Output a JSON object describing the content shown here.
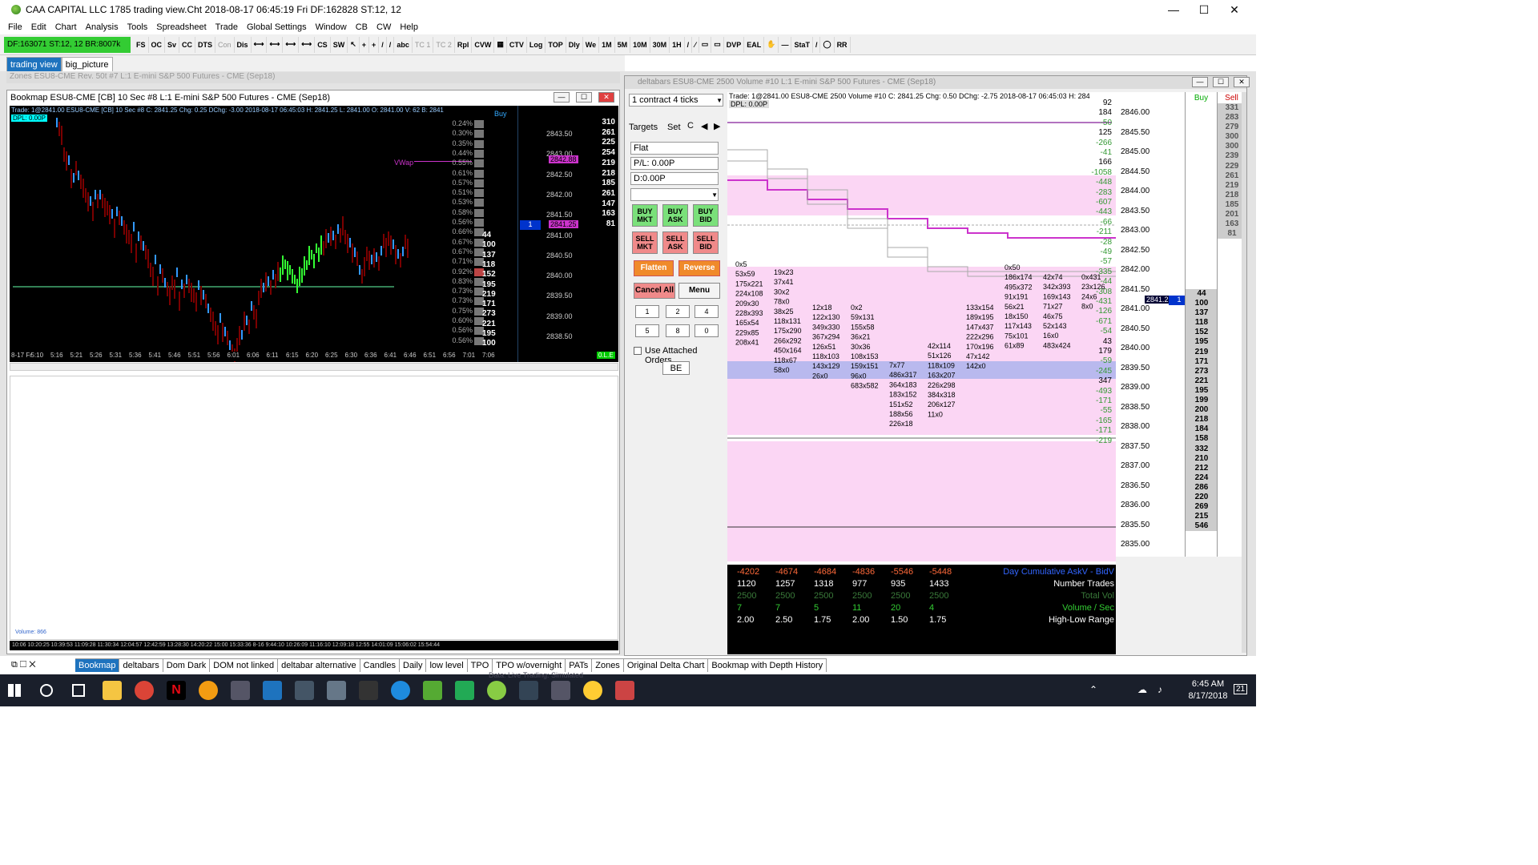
{
  "window": {
    "title": "CAA CAPITAL LLC 1785 trading view.Cht  2018-08-17  06:45:19 Fri  DF:162828  ST:12, 12",
    "minimize": "—",
    "maximize": "☐",
    "close": "✕"
  },
  "menu": [
    "File",
    "Edit",
    "Chart",
    "Analysis",
    "Tools",
    "Spreadsheet",
    "Trade",
    "Global Settings",
    "Window",
    "CB",
    "CW",
    "Help"
  ],
  "toolbar": {
    "status": "DF:163071  ST:12, 12  BR:8007k",
    "buttons": [
      "FS",
      "OC",
      "Sv",
      "CC",
      "DTS",
      "Con",
      "Dis",
      "⟷",
      "⟷",
      "⟷",
      "⟷",
      "CS",
      "SW",
      "↖",
      "+",
      "+",
      "/",
      "/",
      "abc",
      "TC 1",
      "TC 2",
      "Rpl",
      "CVW",
      "▦",
      "CTV",
      "Log",
      "TOP",
      "Dly",
      "We",
      "1M",
      "5M",
      "10M",
      "30M",
      "1H",
      "/",
      "⁄",
      "▭",
      "▭",
      "DVP",
      "EAL",
      "✋",
      "—",
      "StaT",
      "/",
      "◯",
      "RR"
    ]
  },
  "chart_tabs": [
    "trading view",
    "big_picture"
  ],
  "zones_caption": "Zones  ESU8-CME  Rev. 50t  #7  L:1  E-mini S&P 500 Futures - CME (Sep18)",
  "bookmap": {
    "caption": "Bookmap  ESU8-CME [CB]  10 Sec   #8  L:1  E-mini S&P 500 Futures - CME (Sep18)",
    "header": "Trade: 1@2841.00   ESU8-CME [CB]   10 Sec   #8  C: 2841.25  Chg: 0.25  DChg: -3.00  2018-08-17 06:45:03  H: 2841.25  L: 2841.00  O: 2841.00  V: 62  B: 2841",
    "dpl": "DPL: 0.00P",
    "buy_label": "Buy",
    "vwap_label": "VWap",
    "times": [
      "8-17 Fr",
      "5:10",
      "5:16",
      "5:21",
      "5:26",
      "5:31",
      "5:36",
      "5:41",
      "5:46",
      "5:51",
      "5:56",
      "6:01",
      "6:06",
      "6:11",
      "6:15",
      "6:20",
      "6:25",
      "6:30",
      "6:36",
      "6:41",
      "6:46",
      "6:51",
      "6:56",
      "7:01",
      "7:06"
    ],
    "pct": [
      "0.24%",
      "0.30%",
      "0.35%",
      "0.44%",
      "0.55%",
      "0.61%",
      "0.57%",
      "0.51%",
      "0.53%",
      "0.58%",
      "0.56%",
      "0.66%",
      "0.67%",
      "0.67%",
      "0.71%",
      "0.92%",
      "0.83%",
      "0.73%",
      "0.73%",
      "0.75%",
      "0.60%",
      "0.56%",
      "0.56%"
    ],
    "prices": [
      "2843.50",
      "2843.00",
      "2842.50",
      "2842.00",
      "2841.50",
      "2841.00",
      "2840.50",
      "2840.00",
      "2839.50",
      "2839.00",
      "2838.50"
    ],
    "ask_vals": [
      "310",
      "261",
      "225",
      "254",
      "219",
      "218",
      "185",
      "261",
      "147",
      "163",
      "81"
    ],
    "bid_vals": [
      "44",
      "100",
      "137",
      "118",
      "152",
      "195",
      "219",
      "171",
      "273",
      "221",
      "195",
      "100"
    ],
    "current_price": "2842.88",
    "last_price": "2841.25",
    "pos_marker": "1",
    "lower_volume": "Volume: 866",
    "lower_times": "10:06  10:20:25  10:39:53  11:09:28  11:30:34  12:04:57  12:42:59  13:28:30  14:20:22    15:00  15:33:36        8-16  9:44:10  10:26:09  11:16:10  12:09:18       12:55  14:01:09  15:06:02  15:54:44",
    "live_label": "0.L.E"
  },
  "deltabars": {
    "caption": "deltabars  ESU8-CME  2500 Volume  #10  L:1  E-mini S&P 500 Futures - CME (Sep18)",
    "header": "Trade: 1@2841.00   ESU8-CME  2500 Volume  #10  C: 2841.25  Chg: 0.50  DChg: -2.75  2018-08-17 06:45:03  H: 284",
    "dpl": "DPL: 0.00P",
    "contract_select": "1 contract 4 ticks",
    "tabs": [
      "Targets",
      "Set",
      "C"
    ],
    "position": "Flat",
    "pl": "P/L: 0.00P",
    "d": "D:0.00P",
    "buy_mkt": "BUY MKT",
    "buy_ask": "BUY ASK",
    "buy_bid": "BUY BID",
    "sell_mkt": "SELL MKT",
    "sell_ask": "SELL ASK",
    "sell_bid": "SELL BID",
    "flatten": "Flatten",
    "reverse": "Reverse",
    "cancel_all": "Cancel All",
    "menu": "Menu",
    "qty": [
      "1",
      "2",
      "4",
      "5",
      "8",
      "0"
    ],
    "attached": "Use Attached Orders",
    "be": "BE",
    "buy_col": "Buy",
    "sell_col": "Sell",
    "price_axis": [
      "2846.00",
      "2845.50",
      "2845.00",
      "2844.50",
      "2844.00",
      "2843.50",
      "2843.00",
      "2842.50",
      "2842.00",
      "2841.50",
      "2841.00",
      "2840.50",
      "2840.00",
      "2839.50",
      "2839.00",
      "2838.50",
      "2838.00",
      "2837.50",
      "2837.00",
      "2836.50",
      "2836.00",
      "2835.50",
      "2835.00"
    ],
    "current_price": "2841.25",
    "delta_col": [
      "92",
      "184",
      "-50",
      "125",
      "-266",
      "-41",
      "166",
      "-1058",
      "-448",
      "-283",
      "-607",
      "-443",
      "-66",
      "-211",
      "-28",
      "-49",
      "-57",
      "-335",
      "-44",
      "-308",
      "-431",
      "-126",
      "-671",
      "-54",
      "43",
      "179",
      "-59",
      "-245",
      "347",
      "-493",
      "-171",
      "-55",
      "-165",
      "-171",
      "-219"
    ],
    "sell_vals": [
      "331",
      "283",
      "279",
      "300",
      "300",
      "239",
      "229",
      "261",
      "219",
      "218",
      "185",
      "201",
      "163",
      "81"
    ],
    "buy_vals": [
      "44",
      "100",
      "137",
      "118",
      "152",
      "195",
      "219",
      "171",
      "273",
      "221",
      "195",
      "199",
      "200",
      "218",
      "184",
      "158",
      "332",
      "210",
      "212",
      "224",
      "286",
      "220",
      "269",
      "215",
      "546"
    ],
    "stats": {
      "cum_delta": [
        "-4202",
        "-4674",
        "-4684",
        "-4836",
        "-5546",
        "-5448"
      ],
      "num_trades": [
        "1120",
        "1257",
        "1318",
        "977",
        "935",
        "1433"
      ],
      "total_vol": [
        "2500",
        "2500",
        "2500",
        "2500",
        "2500",
        "2500"
      ],
      "vol_sec": [
        "7",
        "7",
        "5",
        "11",
        "20",
        "4"
      ],
      "range": [
        "2.00",
        "2.50",
        "1.75",
        "2.00",
        "1.50",
        "1.75"
      ],
      "labels": [
        "Day Cumulative AskV - BidV",
        "Number Trades",
        "Total Vol",
        "Volume / Sec",
        "High-Low Range"
      ]
    },
    "footprint": [
      [
        "0x5",
        "53x59",
        "175x221",
        "224x108",
        "209x30",
        "228x393",
        "165x54",
        "229x85",
        "208x41"
      ],
      [
        "19x23",
        "37x41",
        "30x2",
        "78x0",
        "38x25",
        "118x131",
        "175x290",
        "266x292",
        "450x164",
        "118x67",
        "58x0"
      ],
      [
        "12x18",
        "122x130",
        "349x330",
        "367x294",
        "126x51",
        "118x103",
        "143x129",
        "26x0"
      ],
      [
        "0x2",
        "59x131",
        "155x58",
        "36x21",
        "30x36",
        "108x153",
        "159x151",
        "96x0",
        "683x582"
      ],
      [
        "7x77",
        "486x317",
        "364x183",
        "183x152",
        "151x52",
        "188x56",
        "226x18"
      ],
      [
        "42x114",
        "51x126",
        "118x109",
        "163x207",
        "226x298",
        "384x318",
        "206x127",
        "11x0"
      ],
      [
        "133x154",
        "189x195",
        "147x437",
        "222x296",
        "170x196",
        "47x142",
        "142x0"
      ],
      [
        "0x50",
        "186x174",
        "495x372",
        "91x191",
        "56x21",
        "18x150",
        "117x143",
        "75x101",
        "61x89"
      ],
      [
        "42x74",
        "342x393",
        "169x143",
        "71x27",
        "46x75",
        "52x143",
        "16x0",
        "483x424"
      ],
      [
        "0x431",
        "23x126",
        "24x6",
        "8x0"
      ]
    ]
  },
  "bottom_tabs": [
    "Bookmap",
    "deltabars",
    "Dom Dark",
    "DOM not linked",
    "deltabar alternative",
    "Candles",
    "Daily",
    "low level",
    "TPO",
    "TPO w/overnight",
    "PATs",
    "Zones",
    "Original Delta Chart",
    "Bookmap with Depth History"
  ],
  "taskbar": {
    "time": "6:45 AM",
    "date": "8/17/2018",
    "notif": "21",
    "ghost_text": "Data: Live    Trading: Simulated"
  }
}
